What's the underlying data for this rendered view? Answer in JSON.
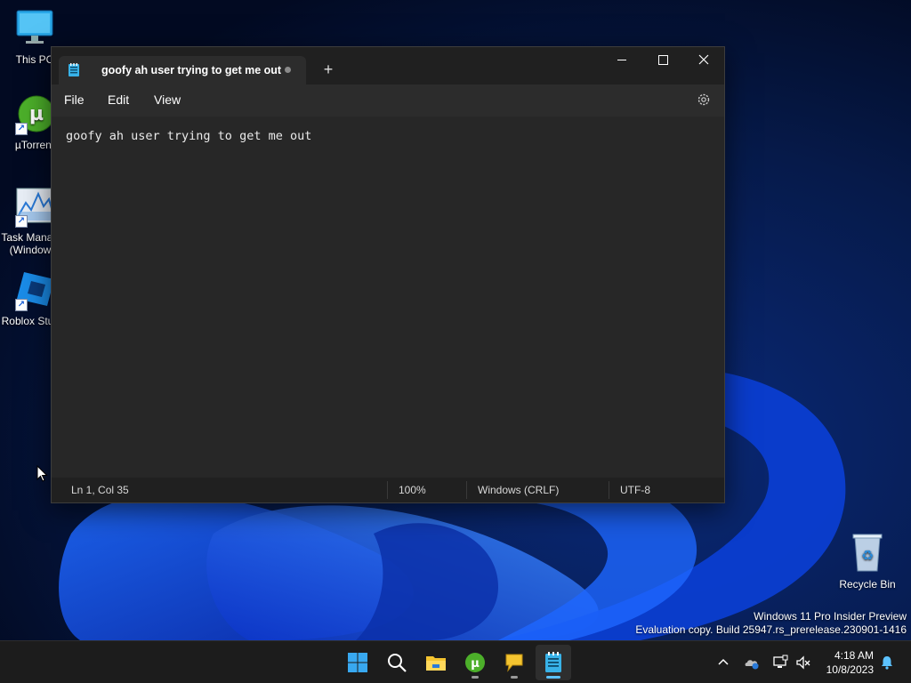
{
  "desktop": {
    "icons": [
      {
        "label": "This PC"
      },
      {
        "label": "µTorrent"
      },
      {
        "label": "Task Manager (Windows)",
        "line1": "Task Manager",
        "line2": "(Windows)"
      },
      {
        "label": "Roblox Studio"
      }
    ],
    "recycle_bin": {
      "label": "Recycle Bin"
    }
  },
  "notepad": {
    "tab_title": "goofy ah user trying to get me out",
    "new_tab_glyph": "+",
    "menu": {
      "file": "File",
      "edit": "Edit",
      "view": "View"
    },
    "editor_text": "goofy ah user trying to get me out",
    "status": {
      "position": "Ln 1, Col 35",
      "zoom": "100%",
      "line_ending": "Windows (CRLF)",
      "encoding": "UTF-8"
    }
  },
  "watermark": {
    "line1": "Windows 11 Pro Insider Preview",
    "line2": "Evaluation copy. Build 25947.rs_prerelease.230901-1416"
  },
  "taskbar": {
    "apps": [
      "start-icon",
      "search-icon",
      "file-explorer-icon",
      "utorrent-icon",
      "feedback-hub-icon",
      "notepad-icon"
    ],
    "clock": {
      "time": "4:18 AM",
      "date": "10/8/2023"
    }
  },
  "colors": {
    "accent": "#5cc2ff",
    "window_bg": "#202020",
    "editor_bg": "#272727",
    "taskbar_bg": "#1c1c1c"
  }
}
